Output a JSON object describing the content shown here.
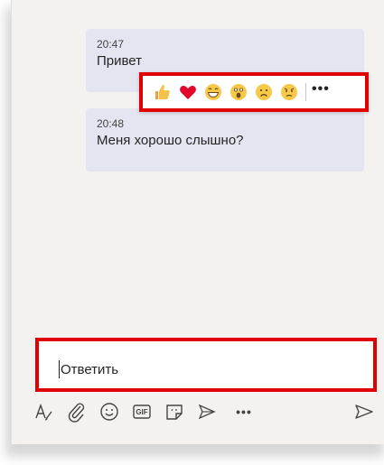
{
  "messages": [
    {
      "time": "20:47",
      "text": "Привет"
    },
    {
      "time": "20:48",
      "text": "Меня хорошо слышно?"
    }
  ],
  "reactions": [
    "like",
    "heart",
    "laugh",
    "surprised",
    "sad",
    "angry"
  ],
  "reactions_more": "•••",
  "compose": {
    "placeholder": "Ответить"
  },
  "toolbar": {
    "icons": [
      "format-icon",
      "attach-icon",
      "emoji-icon",
      "gif-icon",
      "sticker-icon",
      "meet-icon",
      "more-icon",
      "send-icon"
    ],
    "gif_label": "GIF",
    "more_label": "•••"
  },
  "colors": {
    "highlight": "#e00000",
    "bubble": "#e5e5f1",
    "background": "#f3f2f1",
    "accent": "#6264a7"
  }
}
